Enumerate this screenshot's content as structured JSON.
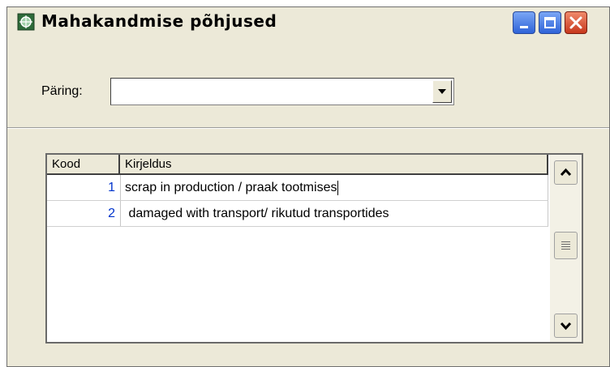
{
  "window": {
    "title": "Mahakandmise põhjused"
  },
  "query": {
    "label": "Päring:",
    "value": ""
  },
  "table": {
    "columns": [
      "Kood",
      "Kirjeldus"
    ],
    "rows": [
      {
        "code": "1",
        "description": "scrap in production / praak tootmises"
      },
      {
        "code": "2",
        "description": " damaged with transport/ rikutud transportides"
      }
    ]
  },
  "icons": {
    "app": "app-window-icon",
    "minimize": "minimize-icon",
    "maximize": "maximize-icon",
    "close": "close-icon",
    "dropdown": "chevron-down-icon",
    "scroll_up": "chevron-up-icon",
    "scroll_down": "chevron-down-icon",
    "scroll_thumb": "scroll-grip-icon"
  },
  "colors": {
    "dialog_bg": "#ece9d8",
    "code_text": "#0033cc",
    "close_button": "#c7381c",
    "title_buttons": "#2f63d8"
  }
}
